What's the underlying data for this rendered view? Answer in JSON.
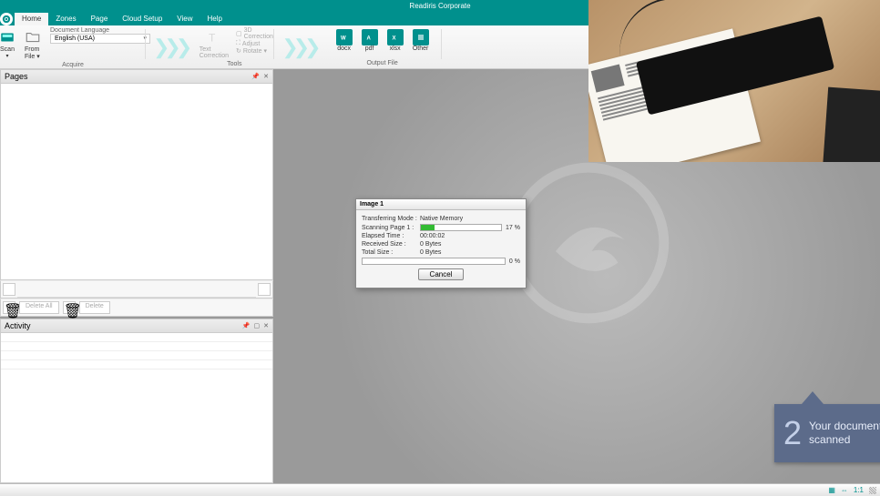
{
  "app": {
    "title": "Readiris Corporate"
  },
  "menu": {
    "tabs": [
      "Home",
      "Zones",
      "Page",
      "Cloud Setup",
      "View",
      "Help"
    ],
    "active": 0
  },
  "ribbon": {
    "acquire": {
      "label": "Acquire",
      "scan": "Scan",
      "fromfile": "From File ▾",
      "lang_label": "Document Language",
      "lang_value": "English (USA)"
    },
    "tools": {
      "label": "Tools",
      "textcorr": "Text Correction",
      "threed": "3D Correction",
      "adjust": "Adjust",
      "rotate": "Rotate ▾"
    },
    "output": {
      "label": "Output File",
      "items": [
        "docx",
        "pdf",
        "xlsx",
        "Other"
      ]
    }
  },
  "panels": {
    "pages": {
      "title": "Pages",
      "delete_all": "Delete All",
      "delete": "Delete"
    },
    "activity": {
      "title": "Activity"
    }
  },
  "dialog": {
    "title": "Image 1",
    "mode_l": "Transferring Mode :",
    "mode_v": "Native Memory",
    "page_l": "Scanning Page 1 :",
    "page_pct": 17,
    "elapsed_l": "Elapsed Time :",
    "elapsed_v": "00:00:02",
    "recv_l": "Received Size :",
    "recv_v": "0 Bytes",
    "total_l": "Total Size :",
    "total_v": "0 Bytes",
    "overall_pct": 0,
    "cancel": "Cancel"
  },
  "callout": {
    "num": "2",
    "text": "Your document is being scanned"
  },
  "status": {
    "zoom": "1:1"
  }
}
